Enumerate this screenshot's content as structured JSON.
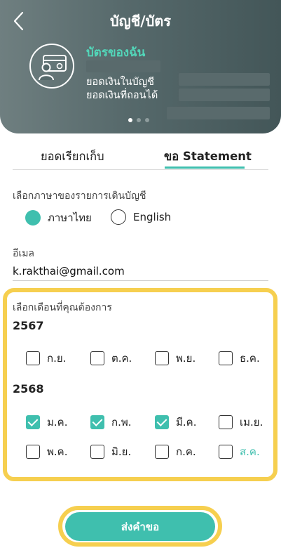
{
  "header": {
    "title": "บัญชี/บัตร",
    "card_name": "บัตรของฉัน",
    "balance_label": "ยอดเงินในบัญชี",
    "available_label": "ยอดเงินที่ถอนได้",
    "carousel_page": 1,
    "carousel_total": 3
  },
  "tabs": [
    {
      "label": "ยอดเรียกเก็บ",
      "active": false
    },
    {
      "label": "ขอ Statement",
      "active": true
    }
  ],
  "language": {
    "label": "เลือกภาษาของรายการเดินบัญชี",
    "options": [
      {
        "label": "ภาษาไทย",
        "selected": true
      },
      {
        "label": "English",
        "selected": false
      }
    ]
  },
  "email": {
    "label": "อีเมล",
    "value": "k.rakthai@gmail.com"
  },
  "months": {
    "label": "เลือกเดือนที่คุณต้องการ",
    "years": [
      {
        "year": "2567",
        "items": [
          {
            "label": "ก.ย.",
            "checked": false
          },
          {
            "label": "ต.ค.",
            "checked": false
          },
          {
            "label": "พ.ย.",
            "checked": false
          },
          {
            "label": "ธ.ค.",
            "checked": false
          }
        ]
      },
      {
        "year": "2568",
        "items": [
          {
            "label": "ม.ค.",
            "checked": true
          },
          {
            "label": "ก.พ.",
            "checked": true
          },
          {
            "label": "มี.ค.",
            "checked": true
          },
          {
            "label": "เม.ย.",
            "checked": false
          },
          {
            "label": "พ.ค.",
            "checked": false
          },
          {
            "label": "มิ.ย.",
            "checked": false
          },
          {
            "label": "ก.ค.",
            "checked": false
          },
          {
            "label": "ส.ค.",
            "checked": false
          }
        ]
      }
    ]
  },
  "submit_label": "ส่งคำขอ",
  "colors": {
    "accent": "#3fbfae",
    "highlight": "#f6cf4f",
    "header_bg": "#56696b",
    "card_name": "#52d6b9"
  }
}
